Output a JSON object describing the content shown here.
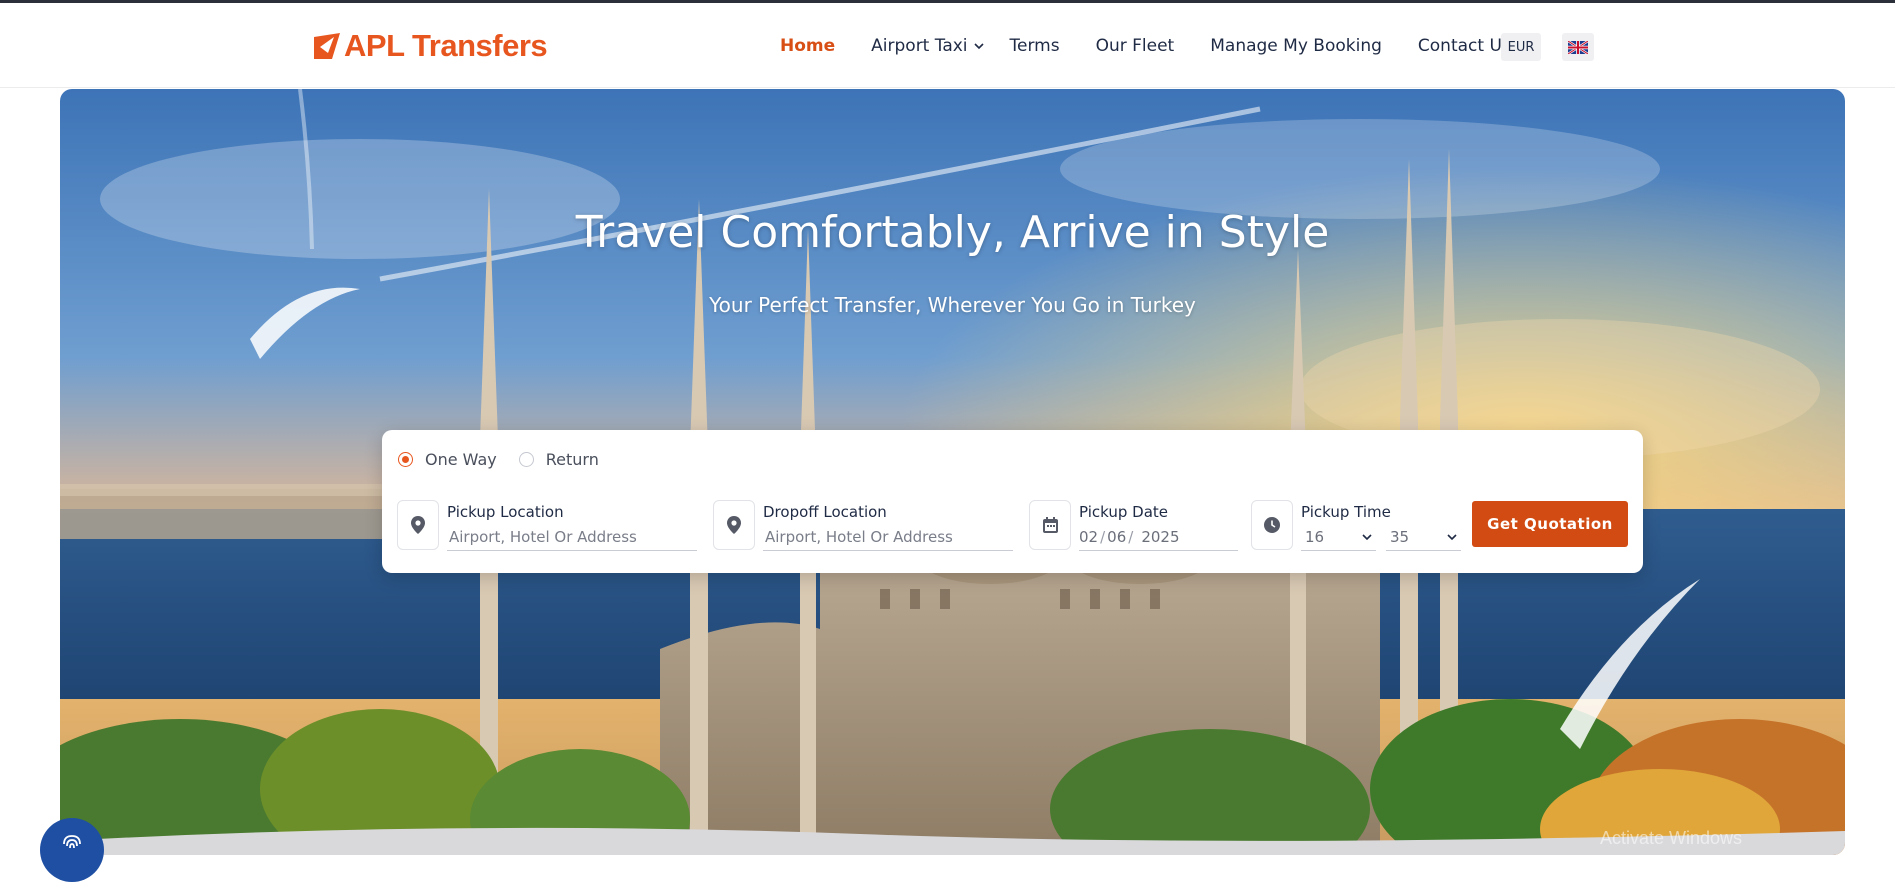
{
  "header": {
    "logo_text": "APL Transfers",
    "nav": [
      {
        "label": "Home",
        "active": true
      },
      {
        "label": "Airport Taxi",
        "has_dropdown": true
      },
      {
        "label": "Terms"
      },
      {
        "label": "Our Fleet"
      },
      {
        "label": "Manage My Booking"
      },
      {
        "label": "Contact Us"
      }
    ],
    "currency": "EUR",
    "language_flag": "uk-flag-icon"
  },
  "hero": {
    "title": "Travel Comfortably, Arrive in Style",
    "subtitle": "Your Perfect Transfer, Wherever You Go in Turkey"
  },
  "booking_form": {
    "trip_types": [
      {
        "label": "One Way",
        "checked": true
      },
      {
        "label": "Return",
        "checked": false
      }
    ],
    "pickup": {
      "label": "Pickup Location",
      "placeholder": "Airport, Hotel Or Address",
      "icon": "map-pin-icon"
    },
    "dropoff": {
      "label": "Dropoff Location",
      "placeholder": "Airport, Hotel Or Address",
      "icon": "map-pin-icon"
    },
    "date": {
      "label": "Pickup Date",
      "day": "02",
      "month": "06",
      "year": "2025",
      "icon": "calendar-icon"
    },
    "time": {
      "label": "Pickup Time",
      "hour": "16",
      "minute": "35",
      "icon": "clock-icon"
    },
    "submit_label": "Get Quotation"
  },
  "system": {
    "watermark": "Activate Windows"
  },
  "colors": {
    "brand": "#e8561f",
    "button": "#d14b12",
    "text_dark": "#1f2a44",
    "fab": "#1f4fa3"
  }
}
